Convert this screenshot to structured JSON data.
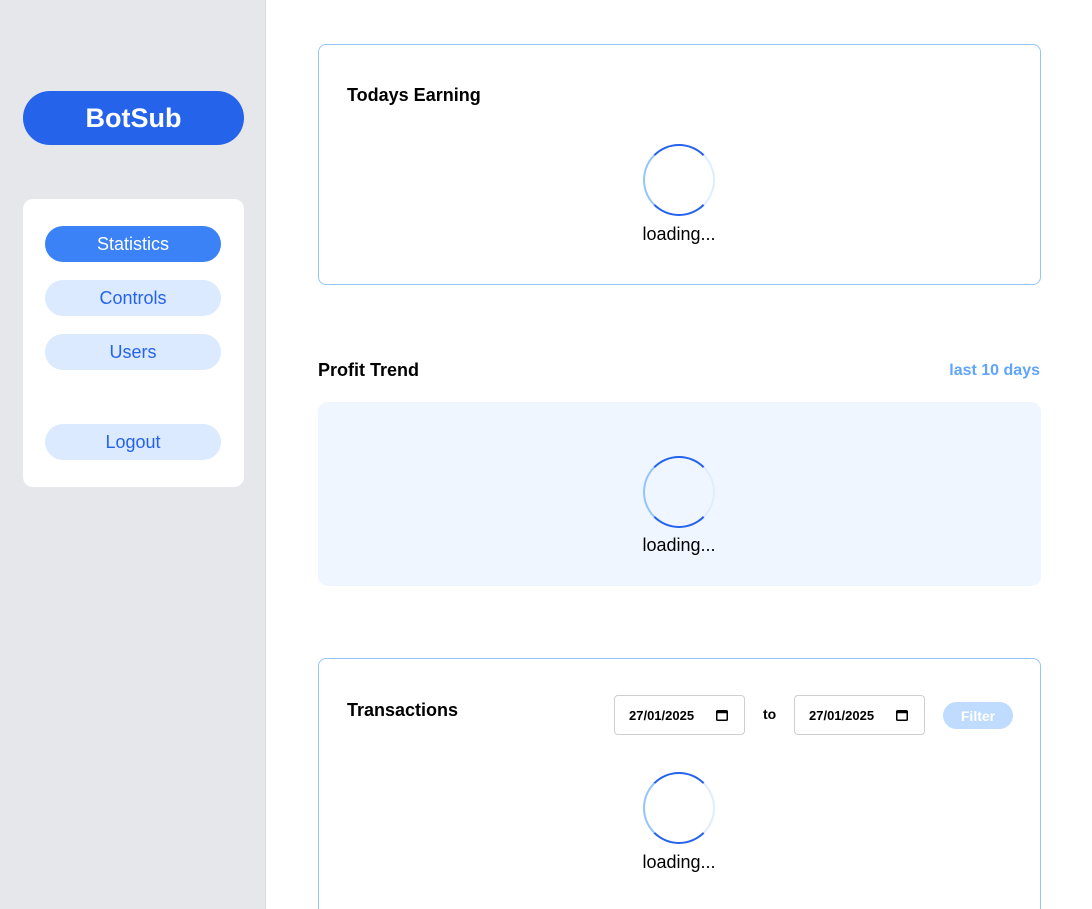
{
  "sidebar": {
    "brand": "BotSub",
    "nav": {
      "statistics": "Statistics",
      "controls": "Controls",
      "users": "Users",
      "logout": "Logout"
    },
    "active": "Statistics"
  },
  "earning": {
    "title": "Todays Earning",
    "loading": "loading..."
  },
  "profit_trend": {
    "title": "Profit Trend",
    "range_link": "last 10 days",
    "loading": "loading..."
  },
  "transactions": {
    "title": "Transactions",
    "date_from": "27/01/2025",
    "to_label": "to",
    "date_to": "27/01/2025",
    "filter_label": "Filter",
    "loading": "loading..."
  },
  "colors": {
    "brand": "#2563eb",
    "active_nav": "#3b82f6",
    "nav_bg": "#dbeafe",
    "card_border": "#93c5fd",
    "link": "#60a5fa",
    "trend_bg": "#eff6ff"
  }
}
